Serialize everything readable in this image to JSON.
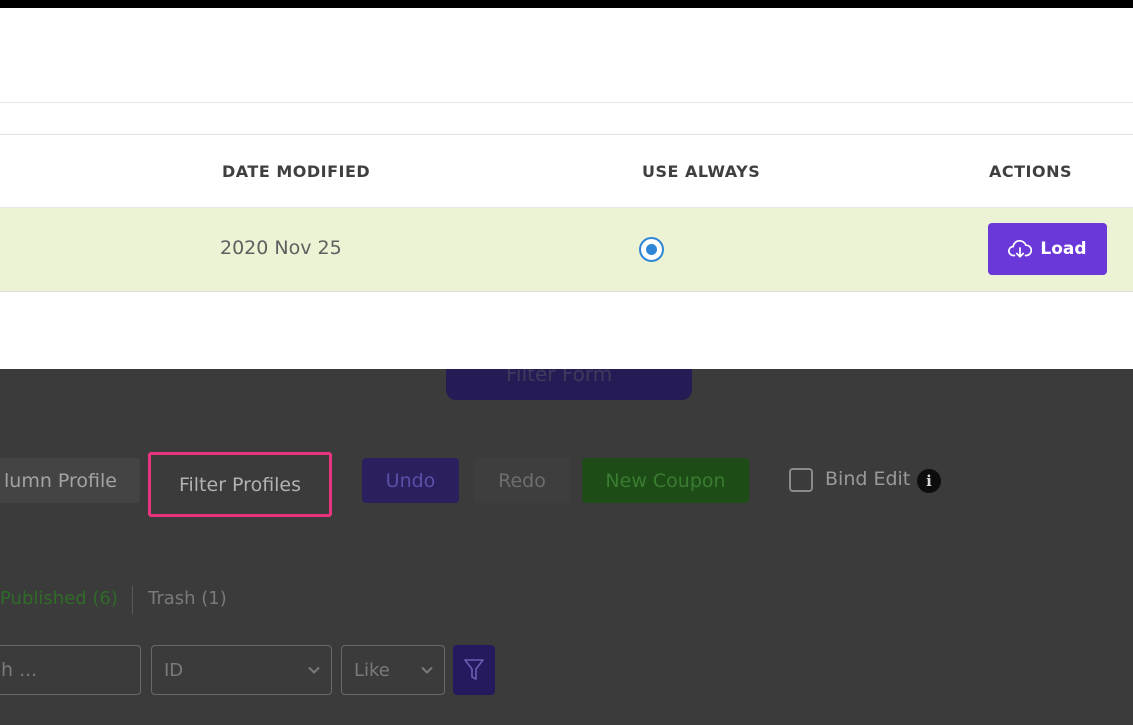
{
  "modal": {
    "columns": {
      "date_modified": "DATE MODIFIED",
      "use_always": "USE ALWAYS",
      "actions": "ACTIONS"
    },
    "rows": [
      {
        "date_modified": "2020 Nov 25",
        "use_always": true,
        "action_label": "Load"
      }
    ]
  },
  "toolbar": {
    "filter_form": "Filter Form",
    "column_profile": "lumn Profile",
    "filter_profiles": "Filter Profiles",
    "undo": "Undo",
    "redo": "Redo",
    "new_coupon": "New Coupon",
    "bind_edit": "Bind Edit",
    "info_icon": "i"
  },
  "status_links": {
    "published": "Published (6)",
    "trash": "Trash (1)"
  },
  "search": {
    "value": "h ...",
    "field": "ID",
    "operator": "Like"
  },
  "colors": {
    "load_button": "#6a38d8",
    "selected_row": "#ebf3d4",
    "highlight_box": "#e8347d",
    "radio": "#2f86d6"
  }
}
